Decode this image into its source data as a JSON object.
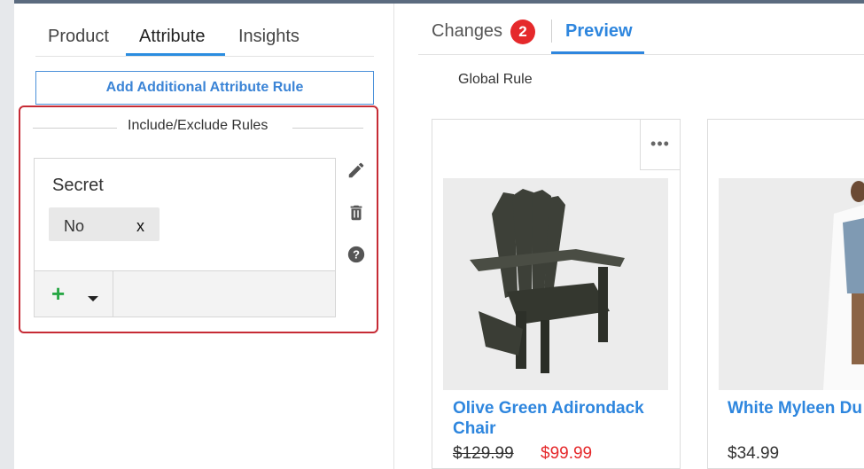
{
  "left_panel": {
    "tabs": [
      {
        "label": "Product"
      },
      {
        "label": "Attribute"
      },
      {
        "label": "Insights"
      }
    ],
    "add_rule_label": "Add Additional Attribute Rule",
    "rules_title": "Include/Exclude Rules",
    "rule": {
      "name": "Secret",
      "values": [
        {
          "label": "No",
          "remove": "x"
        }
      ]
    },
    "footer": {
      "add_icon": "plus-icon",
      "dropdown_icon": "caret-down-icon"
    },
    "side_icons": [
      "pencil-icon",
      "trash-icon",
      "help-icon"
    ]
  },
  "right_panel": {
    "tabs": {
      "changes_label": "Changes",
      "changes_count": "2",
      "preview_label": "Preview"
    },
    "section_label": "Global Rule",
    "products": [
      {
        "title": "Olive Green Adirondack Chair",
        "price_old": "$129.99",
        "price_new": "$99.99",
        "menu": "•••"
      },
      {
        "title": "White Myleen Du Vest",
        "price": "$34.99"
      }
    ]
  },
  "colors": {
    "accent_blue": "#2e86de",
    "badge_red": "#e5292b",
    "rules_border_red": "#c62b35",
    "plus_green": "#28a745"
  }
}
